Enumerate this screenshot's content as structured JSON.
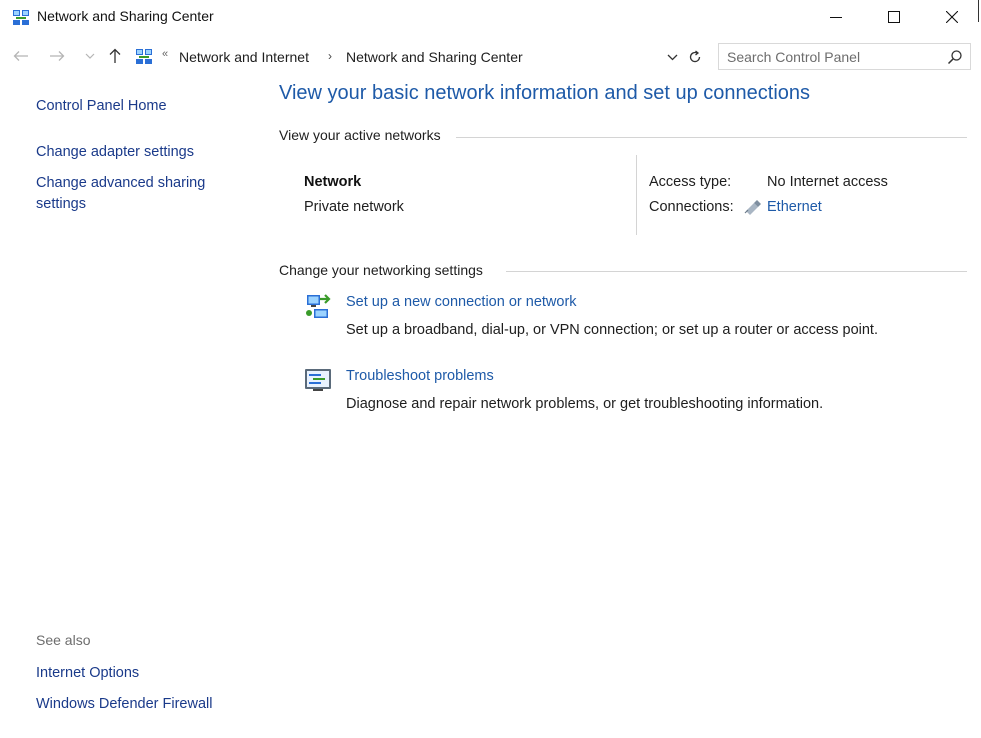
{
  "window": {
    "title": "Network and Sharing Center",
    "icon": "network-sharing-icon"
  },
  "navigation": {
    "breadcrumbs": [
      "Network and Internet",
      "Network and Sharing Center"
    ],
    "search_placeholder": "Search Control Panel"
  },
  "sidebar": {
    "home": "Control Panel Home",
    "links": [
      "Change adapter settings",
      "Change advanced sharing settings"
    ],
    "see_also_heading": "See also",
    "see_also": [
      "Internet Options",
      "Windows Defender Firewall"
    ]
  },
  "main": {
    "title": "View your basic network information and set up connections",
    "active_networks_heading": "View your active networks",
    "network": {
      "name": "Network",
      "type": "Private network",
      "access_type_label": "Access type:",
      "access_type_value": "No Internet access",
      "connections_label": "Connections:",
      "connection_name": "Ethernet"
    },
    "change_settings_heading": "Change your networking settings",
    "tasks": [
      {
        "link": "Set up a new connection or network",
        "description": "Set up a broadband, dial-up, or VPN connection; or set up a router or access point.",
        "icon": "new-connection-icon"
      },
      {
        "link": "Troubleshoot problems",
        "description": "Diagnose and repair network problems, or get troubleshooting information.",
        "icon": "troubleshoot-icon"
      }
    ]
  },
  "colors": {
    "link": "#1e5aa8",
    "nav_link": "#1a3a8a",
    "title": "#1e5aa8",
    "muted": "#6d6d6d"
  }
}
